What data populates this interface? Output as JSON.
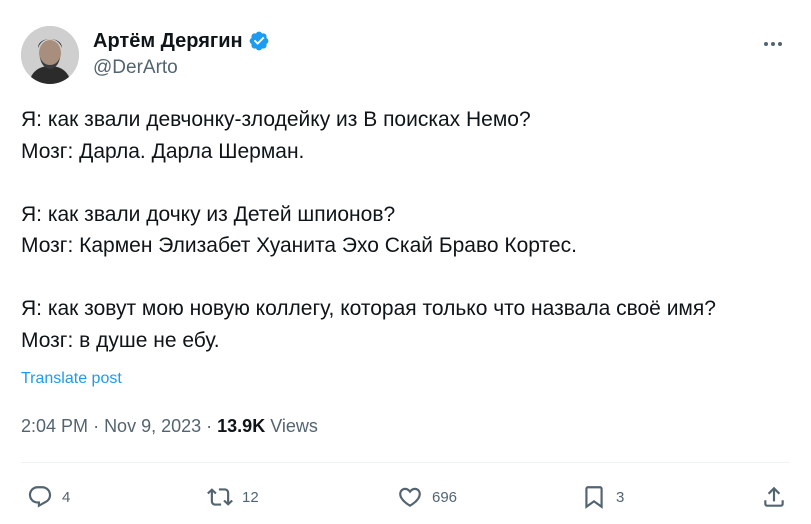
{
  "author": {
    "display_name": "Артём Дерягин",
    "handle": "@DerArto",
    "verified": true,
    "avatar_icon": "avatar-photo"
  },
  "tweet": {
    "lines": [
      "Я: как звали девчонку-злодейку из В поисках Немо?",
      "Мозг: Дарла. Дарла Шерман.",
      "Я: как звали дочку из Детей шпионов?",
      "Мозг: Кармен Элизабет Хуанита Эхо Скай Браво Кортес.",
      "Я: как зовут мою новую коллегу, которая только что назвала своё имя?",
      "Мозг: в душе не ебу."
    ],
    "translate_label": "Translate post",
    "time": "2:04 PM",
    "separator": "·",
    "date": "Nov 9, 2023",
    "views_count": "13.9K",
    "views_label": "Views"
  },
  "actions": {
    "replies": "4",
    "reposts": "12",
    "likes": "696",
    "bookmarks": "3"
  },
  "colors": {
    "text": "#0f1419",
    "secondary": "#536471",
    "link": "#1d9bf0",
    "verified": "#1d9bf0"
  }
}
